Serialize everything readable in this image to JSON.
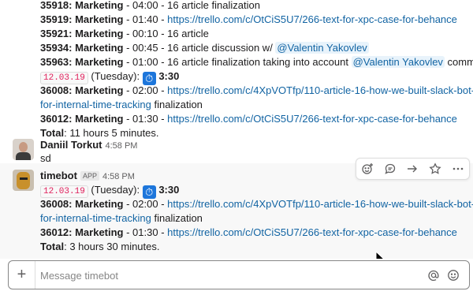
{
  "history": {
    "lines": [
      {
        "id": "35918: ",
        "rest": "Marketing",
        "tail": " - 04:00 - 16 article finalization"
      },
      {
        "id": "35919: ",
        "rest": "Marketing",
        "tail": " - 01:40 - "
      },
      {
        "id": "35921: ",
        "rest": "Marketing",
        "tail": " - 00:10 - 16 article"
      },
      {
        "id": "35934: ",
        "rest": "Marketing",
        "tail": " - 00:45 - 16 article discussion w/ "
      },
      {
        "id": "35963: ",
        "rest": "Marketing",
        "tail": " - 01:00 - 16 article finalization taking into account "
      }
    ],
    "link_35919": "https://trello.com/c/OtCiS5U7/266-text-for-xpc-case-for-behance",
    "mention_1": "@Valentin Yakovlev",
    "mention_2": "@Valentin Yakovlev",
    "after_mention_2": " comments",
    "date_chip": "12.03.19",
    "day": " (Tuesday): ",
    "total_time": "3:30",
    "line_36008_id": "36008: ",
    "line_36008_dept": "Marketing",
    "line_36008_tail": " - 02:00 - ",
    "link_36008_a": "https://trello.com/c/4XpVOTfp/110-article-16-how-we-built-slack-bot-",
    "link_36008_b": "for-internal-time-tracking",
    "after_36008": " finalization",
    "line_36012_id": "36012: ",
    "line_36012_dept": "Marketing",
    "line_36012_tail": " - 01:30 - ",
    "link_36012": "https://trello.com/c/OtCiS5U7/266-text-for-xpc-case-for-behance",
    "total_label": "Total",
    "total_value": ": 11 hours 5 minutes."
  },
  "msg_daniil": {
    "sender": "Daniil Torkut",
    "time": "4:58 PM",
    "text": "sd"
  },
  "msg_bot": {
    "sender": "timebot",
    "badge": "APP",
    "time": "4:58 PM",
    "date_chip": "12.03.19",
    "day": " (Tuesday): ",
    "total_time": "3:30",
    "line1_id": "36008: ",
    "line1_dept": "Marketing",
    "line1_tail": " - 02:00 - ",
    "line1_link_a": "https://trello.com/c/4XpVOTfp/110-article-16-how-we-built-slack-bot-",
    "line1_link_b": "for-internal-time-tracking",
    "line1_after": " finalization",
    "line2_id": "36012: ",
    "line2_dept": "Marketing",
    "line2_tail": " - 01:30 - ",
    "line2_link": "https://trello.com/c/OtCiS5U7/266-text-for-xpc-case-for-behance",
    "total_label": "Total",
    "total_value": ": 3 hours 30 minutes."
  },
  "composer": {
    "placeholder": "Message timebot"
  },
  "icons": {
    "add_reaction": "add-reaction-icon",
    "reply_thread": "reply-thread-icon",
    "share": "share-icon",
    "star": "star-icon",
    "more": "more-actions-icon",
    "plus": "plus-icon",
    "mention": "mention-icon",
    "emoji": "emoji-icon",
    "stopwatch": "stopwatch-icon"
  }
}
